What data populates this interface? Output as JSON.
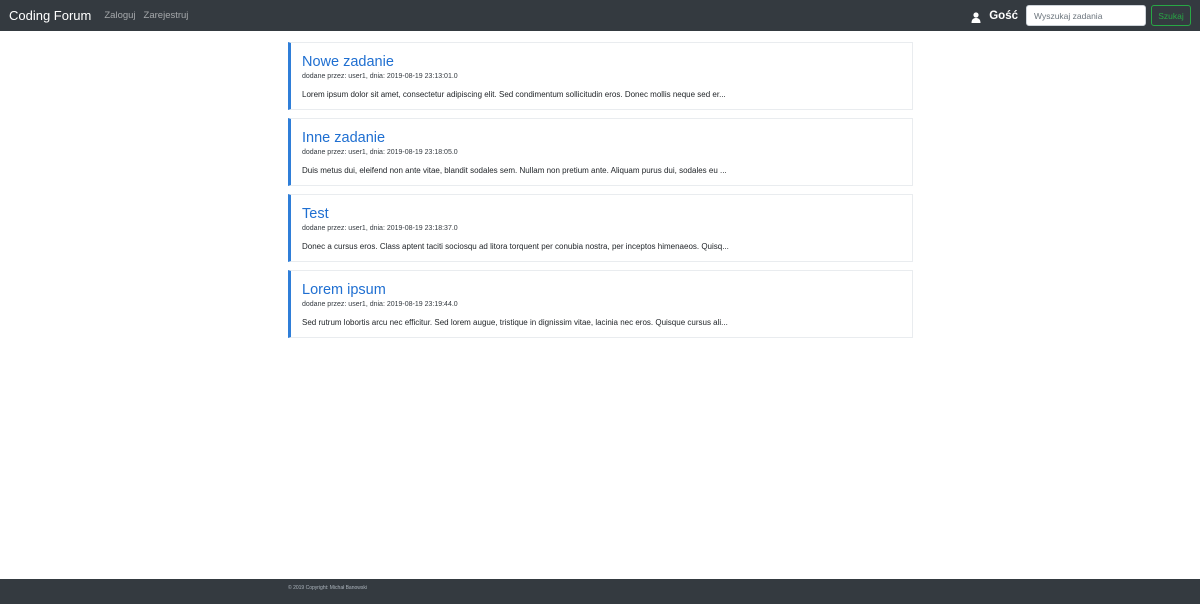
{
  "navbar": {
    "brand": "Coding Forum",
    "links": [
      "Zaloguj",
      "Zarejestruj"
    ],
    "user_icon": "user-icon",
    "user_name": "Gość",
    "search_placeholder": "Wyszukaj zadania",
    "search_button": "Szukaj"
  },
  "posts": [
    {
      "title": "Nowe zadanie",
      "meta": "dodane przez: user1, dnia: 2019-08-19 23:13:01.0",
      "excerpt": "Lorem ipsum dolor sit amet, consectetur adipiscing elit. Sed condimentum sollicitudin eros. Donec mollis neque sed er..."
    },
    {
      "title": "Inne zadanie",
      "meta": "dodane przez: user1, dnia: 2019-08-19 23:18:05.0",
      "excerpt": "Duis metus dui, eleifend non ante vitae, blandit sodales sem. Nullam non pretium ante. Aliquam purus dui, sodales eu ..."
    },
    {
      "title": "Test",
      "meta": "dodane przez: user1, dnia: 2019-08-19 23:18:37.0",
      "excerpt": "Donec a cursus eros. Class aptent taciti sociosqu ad litora torquent per conubia nostra, per inceptos himenaeos. Quisq..."
    },
    {
      "title": "Lorem ipsum",
      "meta": "dodane przez: user1, dnia: 2019-08-19 23:19:44.0",
      "excerpt": "Sed rutrum lobortis arcu nec efficitur. Sed lorem augue, tristique in dignissim vitae, lacinia nec eros. Quisque cursus ali..."
    }
  ],
  "footer": {
    "copyright": "© 2019 Copyright: Michał Banowski"
  },
  "colors": {
    "navbar_bg": "#343a40",
    "accent": "#2f7ed8",
    "success": "#28a745"
  }
}
